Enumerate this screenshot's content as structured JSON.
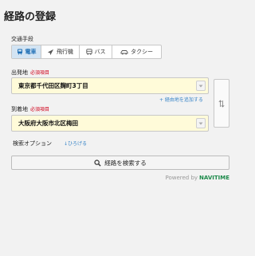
{
  "page": {
    "title": "経路の登録"
  },
  "transport": {
    "label": "交通手段",
    "tabs": [
      {
        "label": "電車",
        "icon": "train-icon"
      },
      {
        "label": "飛行機",
        "icon": "airplane-icon"
      },
      {
        "label": "バス",
        "icon": "bus-icon"
      },
      {
        "label": "タクシー",
        "icon": "taxi-icon"
      }
    ],
    "selected": "電車"
  },
  "required_tag": "必須項目",
  "departure": {
    "label": "出発地",
    "value": "東京都千代田区麹町3丁目"
  },
  "via": {
    "add_label": "+ 経由地を追加する"
  },
  "arrival": {
    "label": "到着地",
    "value": "大阪府大阪市北区梅田"
  },
  "options": {
    "label": "検索オプション",
    "toggle_label": "↓ひろげる"
  },
  "search_button": {
    "label": "経路を検索する"
  },
  "footer": {
    "powered_by": "Powered by",
    "brand": "NAVITIME"
  },
  "colors": {
    "accent": "#1f6fb5",
    "required": "#d0021b",
    "field_bg": "#fffbd9",
    "brand": "#1c8a4a"
  }
}
